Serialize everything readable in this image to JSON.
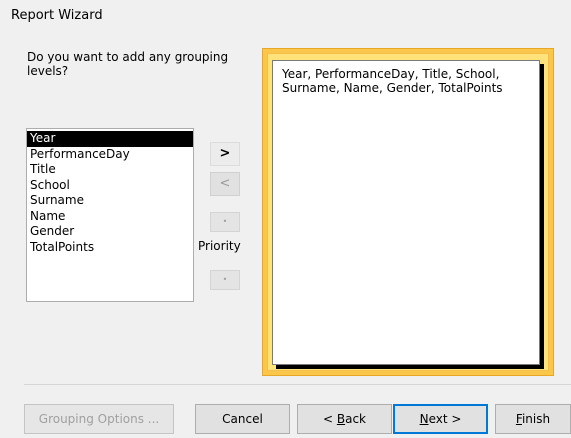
{
  "window": {
    "title": "Report Wizard"
  },
  "question": "Do you want to add any grouping levels?",
  "fields": [
    {
      "label": "Year",
      "selected": true
    },
    {
      "label": "PerformanceDay",
      "selected": false
    },
    {
      "label": "Title",
      "selected": false
    },
    {
      "label": "School",
      "selected": false
    },
    {
      "label": "Surname",
      "selected": false
    },
    {
      "label": "Name",
      "selected": false
    },
    {
      "label": "Gender",
      "selected": false
    },
    {
      "label": "TotalPoints",
      "selected": false
    }
  ],
  "move_buttons": {
    "add_label": ">",
    "remove_label": "<",
    "priority_up_label": "•",
    "priority_down_label": "•",
    "priority_label": "Priority"
  },
  "preview": {
    "text": "Year, PerformanceDay, Title, School, Surname, Name, Gender, TotalPoints",
    "frame_color": "#fbc64c",
    "glow_color": "#ffe27a"
  },
  "footer": {
    "grouping_options_label": "Grouping Options ...",
    "cancel_label": "Cancel",
    "back_prefix": "< ",
    "back_mnemonic": "B",
    "back_rest": "ack",
    "next_mnemonic": "N",
    "next_rest": "ext >",
    "finish_mnemonic": "F",
    "finish_rest": "inish",
    "accent_color": "#0078d7"
  }
}
